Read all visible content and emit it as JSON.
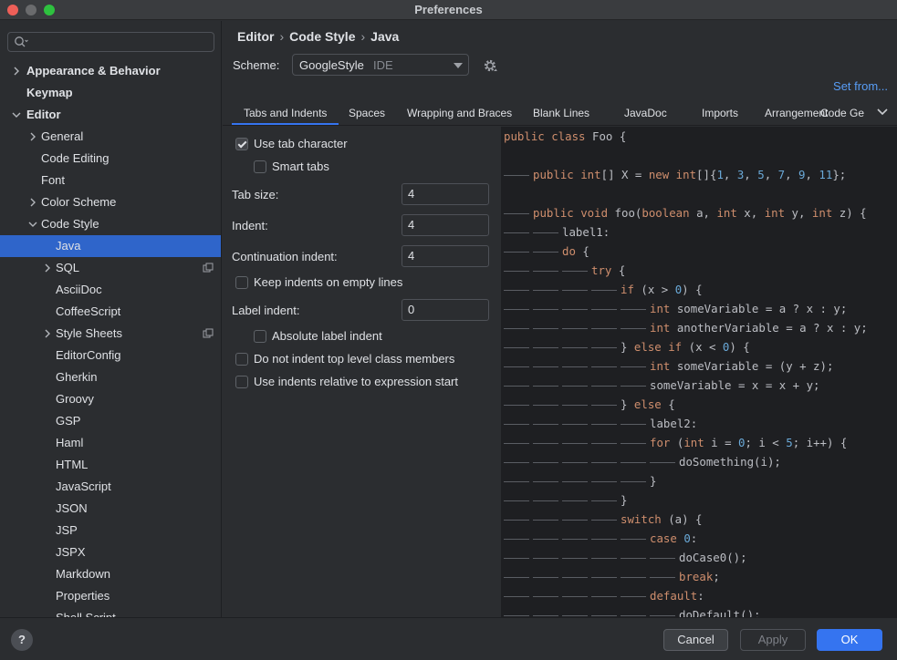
{
  "window": {
    "title": "Preferences"
  },
  "sidebar": {
    "search_placeholder": "",
    "items": [
      {
        "label": "Appearance & Behavior",
        "bold": true,
        "chevron": "right",
        "level": 0
      },
      {
        "label": "Keymap",
        "bold": true,
        "chevron": "none",
        "level": 0
      },
      {
        "label": "Editor",
        "bold": true,
        "chevron": "down",
        "level": 0
      },
      {
        "label": "General",
        "bold": false,
        "chevron": "right",
        "level": 1
      },
      {
        "label": "Code Editing",
        "bold": false,
        "chevron": "none",
        "level": 1
      },
      {
        "label": "Font",
        "bold": false,
        "chevron": "none",
        "level": 1
      },
      {
        "label": "Color Scheme",
        "bold": false,
        "chevron": "right",
        "level": 1
      },
      {
        "label": "Code Style",
        "bold": false,
        "chevron": "down",
        "level": 1
      },
      {
        "label": "Java",
        "bold": false,
        "chevron": "none",
        "level": 2,
        "selected": true
      },
      {
        "label": "SQL",
        "bold": false,
        "chevron": "right",
        "level": 2,
        "copy_icon": true
      },
      {
        "label": "AsciiDoc",
        "bold": false,
        "chevron": "none",
        "level": 2
      },
      {
        "label": "CoffeeScript",
        "bold": false,
        "chevron": "none",
        "level": 2
      },
      {
        "label": "Style Sheets",
        "bold": false,
        "chevron": "right",
        "level": 2,
        "copy_icon": true
      },
      {
        "label": "EditorConfig",
        "bold": false,
        "chevron": "none",
        "level": 2
      },
      {
        "label": "Gherkin",
        "bold": false,
        "chevron": "none",
        "level": 2
      },
      {
        "label": "Groovy",
        "bold": false,
        "chevron": "none",
        "level": 2
      },
      {
        "label": "GSP",
        "bold": false,
        "chevron": "none",
        "level": 2
      },
      {
        "label": "Haml",
        "bold": false,
        "chevron": "none",
        "level": 2
      },
      {
        "label": "HTML",
        "bold": false,
        "chevron": "none",
        "level": 2
      },
      {
        "label": "JavaScript",
        "bold": false,
        "chevron": "none",
        "level": 2
      },
      {
        "label": "JSON",
        "bold": false,
        "chevron": "none",
        "level": 2
      },
      {
        "label": "JSP",
        "bold": false,
        "chevron": "none",
        "level": 2
      },
      {
        "label": "JSPX",
        "bold": false,
        "chevron": "none",
        "level": 2
      },
      {
        "label": "Markdown",
        "bold": false,
        "chevron": "none",
        "level": 2
      },
      {
        "label": "Properties",
        "bold": false,
        "chevron": "none",
        "level": 2
      },
      {
        "label": "Shell Script",
        "bold": false,
        "chevron": "none",
        "level": 2
      }
    ]
  },
  "breadcrumb": {
    "items": [
      "Editor",
      "Code Style",
      "Java"
    ],
    "separator": "›"
  },
  "scheme": {
    "label": "Scheme:",
    "value": "GoogleStyle",
    "tag": "IDE"
  },
  "set_from": "Set from...",
  "tabs": [
    "Tabs and Indents",
    "Spaces",
    "Wrapping and Braces",
    "Blank Lines",
    "JavaDoc",
    "Imports",
    "Arrangement",
    "Code Ge"
  ],
  "active_tab": 0,
  "settings": {
    "use_tab_character": {
      "label": "Use tab character",
      "checked": true
    },
    "smart_tabs": {
      "label": "Smart tabs",
      "checked": false
    },
    "tab_size": {
      "label": "Tab size:",
      "value": "4"
    },
    "indent": {
      "label": "Indent:",
      "value": "4"
    },
    "continuation_indent": {
      "label": "Continuation indent:",
      "value": "4"
    },
    "keep_indents": {
      "label": "Keep indents on empty lines",
      "checked": false
    },
    "label_indent": {
      "label": "Label indent:",
      "value": "0"
    },
    "absolute_label_indent": {
      "label": "Absolute label indent",
      "checked": false
    },
    "no_indent_top_level": {
      "label": "Do not indent top level class members",
      "checked": false
    },
    "indent_relative": {
      "label": "Use indents relative to expression start",
      "checked": false
    }
  },
  "code_preview": {
    "colors": {
      "keyword": "#cf8e6d",
      "number": "#6aa9d8",
      "plain": "#bcbec4"
    },
    "lines": [
      {
        "indent": 0,
        "tokens": [
          [
            "kw",
            "public class "
          ],
          [
            "plain",
            "Foo {"
          ]
        ]
      },
      {
        "indent": 0,
        "tokens": []
      },
      {
        "indent": 1,
        "tokens": [
          [
            "kw",
            "public int"
          ],
          [
            "plain",
            "[] X = "
          ],
          [
            "kw",
            "new int"
          ],
          [
            "plain",
            "[]{"
          ],
          [
            "num",
            "1"
          ],
          [
            "plain",
            ", "
          ],
          [
            "num",
            "3"
          ],
          [
            "plain",
            ", "
          ],
          [
            "num",
            "5"
          ],
          [
            "plain",
            ", "
          ],
          [
            "num",
            "7"
          ],
          [
            "plain",
            ", "
          ],
          [
            "num",
            "9"
          ],
          [
            "plain",
            ", "
          ],
          [
            "num",
            "11"
          ],
          [
            "plain",
            "};"
          ]
        ]
      },
      {
        "indent": 0,
        "tokens": []
      },
      {
        "indent": 1,
        "tokens": [
          [
            "kw",
            "public void "
          ],
          [
            "plain",
            "foo("
          ],
          [
            "kw",
            "boolean "
          ],
          [
            "plain",
            "a, "
          ],
          [
            "kw",
            "int "
          ],
          [
            "plain",
            "x, "
          ],
          [
            "kw",
            "int "
          ],
          [
            "plain",
            "y, "
          ],
          [
            "kw",
            "int "
          ],
          [
            "plain",
            "z) {"
          ]
        ]
      },
      {
        "indent": 2,
        "tokens": [
          [
            "plain",
            "label1:"
          ]
        ]
      },
      {
        "indent": 2,
        "tokens": [
          [
            "kw",
            "do "
          ],
          [
            "plain",
            "{"
          ]
        ]
      },
      {
        "indent": 3,
        "tokens": [
          [
            "kw",
            "try "
          ],
          [
            "plain",
            "{"
          ]
        ]
      },
      {
        "indent": 4,
        "tokens": [
          [
            "kw",
            "if "
          ],
          [
            "plain",
            "(x > "
          ],
          [
            "num",
            "0"
          ],
          [
            "plain",
            ") {"
          ]
        ]
      },
      {
        "indent": 5,
        "tokens": [
          [
            "kw",
            "int "
          ],
          [
            "plain",
            "someVariable = a ? x : y;"
          ]
        ]
      },
      {
        "indent": 5,
        "tokens": [
          [
            "kw",
            "int "
          ],
          [
            "plain",
            "anotherVariable = a ? x : y;"
          ]
        ]
      },
      {
        "indent": 4,
        "tokens": [
          [
            "plain",
            "} "
          ],
          [
            "kw",
            "else if "
          ],
          [
            "plain",
            "(x < "
          ],
          [
            "num",
            "0"
          ],
          [
            "plain",
            ") {"
          ]
        ]
      },
      {
        "indent": 5,
        "tokens": [
          [
            "kw",
            "int "
          ],
          [
            "plain",
            "someVariable = (y + z);"
          ]
        ]
      },
      {
        "indent": 5,
        "tokens": [
          [
            "plain",
            "someVariable = x = x + y;"
          ]
        ]
      },
      {
        "indent": 4,
        "tokens": [
          [
            "plain",
            "} "
          ],
          [
            "kw",
            "else "
          ],
          [
            "plain",
            "{"
          ]
        ]
      },
      {
        "indent": 5,
        "tokens": [
          [
            "plain",
            "label2:"
          ]
        ]
      },
      {
        "indent": 5,
        "tokens": [
          [
            "kw",
            "for "
          ],
          [
            "plain",
            "("
          ],
          [
            "kw",
            "int "
          ],
          [
            "plain",
            "i = "
          ],
          [
            "num",
            "0"
          ],
          [
            "plain",
            "; i < "
          ],
          [
            "num",
            "5"
          ],
          [
            "plain",
            "; i++) {"
          ]
        ]
      },
      {
        "indent": 6,
        "tokens": [
          [
            "plain",
            "doSomething(i);"
          ]
        ]
      },
      {
        "indent": 5,
        "tokens": [
          [
            "plain",
            "}"
          ]
        ]
      },
      {
        "indent": 4,
        "tokens": [
          [
            "plain",
            "}"
          ]
        ]
      },
      {
        "indent": 4,
        "tokens": [
          [
            "kw",
            "switch "
          ],
          [
            "plain",
            "(a) {"
          ]
        ]
      },
      {
        "indent": 5,
        "tokens": [
          [
            "kw",
            "case "
          ],
          [
            "num",
            "0"
          ],
          [
            "plain",
            ":"
          ]
        ]
      },
      {
        "indent": 6,
        "tokens": [
          [
            "plain",
            "doCase0();"
          ]
        ]
      },
      {
        "indent": 6,
        "tokens": [
          [
            "kw",
            "break"
          ],
          [
            "plain",
            ";"
          ]
        ]
      },
      {
        "indent": 5,
        "tokens": [
          [
            "kw",
            "default"
          ],
          [
            "plain",
            ":"
          ]
        ]
      },
      {
        "indent": 6,
        "tokens": [
          [
            "plain",
            "doDefault();"
          ]
        ]
      }
    ]
  },
  "footer": {
    "help_label": "?",
    "cancel_label": "Cancel",
    "apply_label": "Apply",
    "ok_label": "OK"
  }
}
